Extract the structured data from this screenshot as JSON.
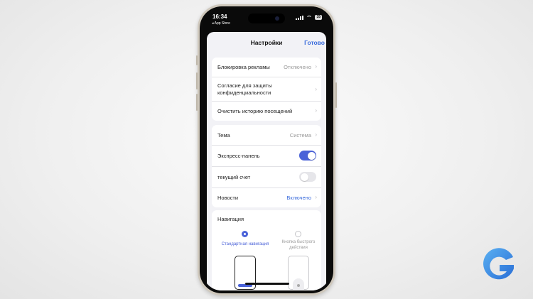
{
  "status_bar": {
    "time": "16:34",
    "back_label": "◂ App Store",
    "battery": "35"
  },
  "sheet": {
    "title": "Настройки",
    "done_label": "Готово"
  },
  "group1": [
    {
      "label": "Блокировка рекламы",
      "value": "Отключено"
    },
    {
      "label": "Согласие для защиты конфиденциальности",
      "value": ""
    },
    {
      "label": "Очистить историю посещений",
      "value": ""
    }
  ],
  "group2": {
    "theme": {
      "label": "Тема",
      "value": "Система"
    },
    "express_panel": {
      "label": "Экспресс-панель",
      "enabled": true
    },
    "current_account": {
      "label": "текущий счет",
      "enabled": false
    },
    "news": {
      "label": "Новости",
      "value": "Включено"
    }
  },
  "navigation": {
    "title": "Навигация",
    "options": [
      {
        "label": "Стандартная навигация",
        "selected": true
      },
      {
        "label": "Кнопка быстрого действия",
        "selected": false
      }
    ]
  },
  "colors": {
    "accent": "#4a62d8",
    "link": "#3a6cdc",
    "logo": "#3a8ee6"
  },
  "icons": {
    "chevron": "›",
    "logo": "g-logo-icon"
  }
}
